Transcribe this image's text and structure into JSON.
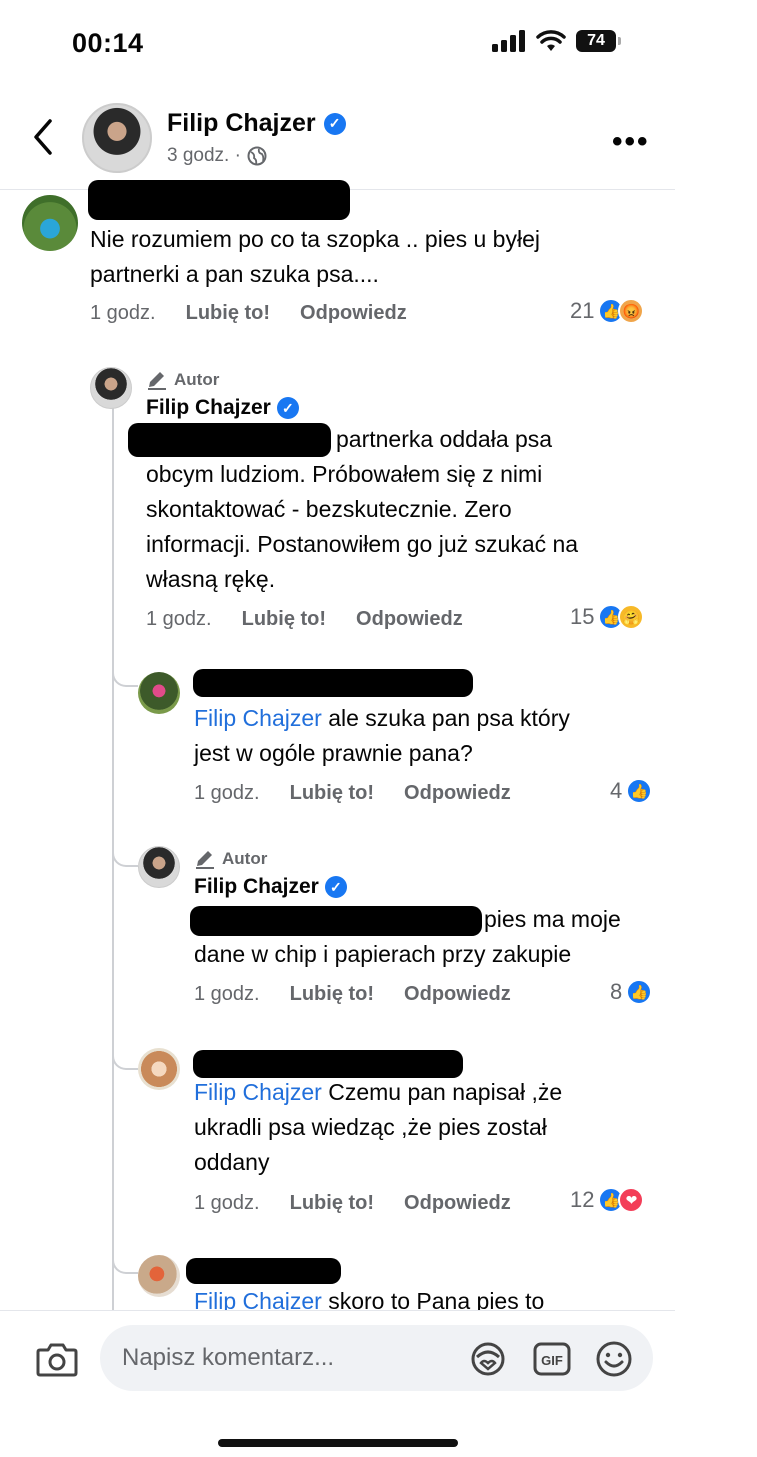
{
  "status": {
    "time": "00:14",
    "battery": "74"
  },
  "header": {
    "name": "Filip Chajzer",
    "meta": "3 godz. ·"
  },
  "labels": {
    "time": "1 godz.",
    "like": "Lubię to!",
    "reply": "Odpowiedz",
    "author": "Autor"
  },
  "comments": [
    {
      "text": [
        "Nie rozumiem po co ta szopka .. pies u byłej",
        "partnerki a pan szuka psa...."
      ],
      "count": "21"
    },
    {
      "name": "Filip Chajzer",
      "text": [
        "partnerka oddała psa",
        "obcym ludziom. Próbowałem się z nimi",
        "skontaktować - bezskutecznie. Zero",
        "informacji. Postanowiłem go już szukać na",
        "własną rękę."
      ],
      "count": "15"
    },
    {
      "mention": "Filip Chajzer",
      "text": [
        " ale szuka pan psa który",
        "jest w ogóle prawnie pana?"
      ],
      "count": "4"
    },
    {
      "name": "Filip Chajzer",
      "text": [
        "pies ma moje",
        "dane w chip i papierach przy zakupie"
      ],
      "count": "8"
    },
    {
      "mention": "Filip Chajzer",
      "text": [
        " Czemu pan napisał ,że",
        "ukradli psa wiedząc ,że pies został",
        "oddany"
      ],
      "count": "12"
    },
    {
      "mention": "Filip Chajzer",
      "text": [
        " skoro to Pana pies to"
      ]
    }
  ],
  "composer": {
    "placeholder": "Napisz komentarz..."
  },
  "icons": [
    "back-icon",
    "verified-icon",
    "globe-icon",
    "more-icon",
    "edit-icon",
    "like-reaction-icon",
    "angry-reaction-icon",
    "care-reaction-icon",
    "love-reaction-icon",
    "camera-icon",
    "avatar-sticker-icon",
    "gif-icon",
    "emoji-icon"
  ],
  "colors": {
    "accent": "#1877f2",
    "mention": "#216fdb",
    "secondary": "#65676b"
  }
}
